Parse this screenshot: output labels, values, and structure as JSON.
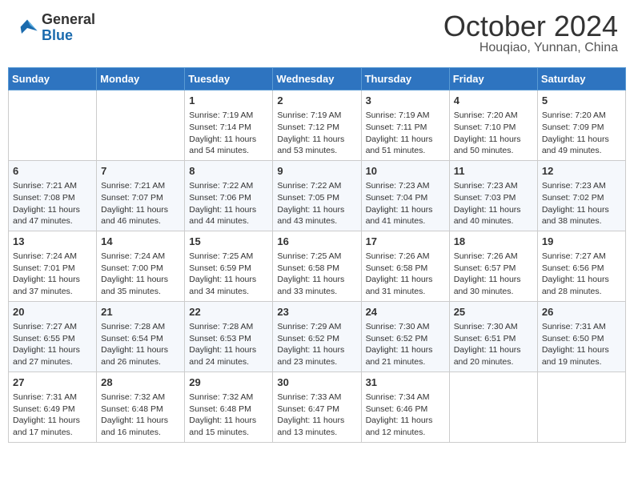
{
  "header": {
    "logo_general": "General",
    "logo_blue": "Blue",
    "title": "October 2024",
    "subtitle": "Houqiao, Yunnan, China"
  },
  "days_of_week": [
    "Sunday",
    "Monday",
    "Tuesday",
    "Wednesday",
    "Thursday",
    "Friday",
    "Saturday"
  ],
  "weeks": [
    [
      {
        "day": "",
        "info": ""
      },
      {
        "day": "",
        "info": ""
      },
      {
        "day": "1",
        "info": "Sunrise: 7:19 AM\nSunset: 7:14 PM\nDaylight: 11 hours and 54 minutes."
      },
      {
        "day": "2",
        "info": "Sunrise: 7:19 AM\nSunset: 7:12 PM\nDaylight: 11 hours and 53 minutes."
      },
      {
        "day": "3",
        "info": "Sunrise: 7:19 AM\nSunset: 7:11 PM\nDaylight: 11 hours and 51 minutes."
      },
      {
        "day": "4",
        "info": "Sunrise: 7:20 AM\nSunset: 7:10 PM\nDaylight: 11 hours and 50 minutes."
      },
      {
        "day": "5",
        "info": "Sunrise: 7:20 AM\nSunset: 7:09 PM\nDaylight: 11 hours and 49 minutes."
      }
    ],
    [
      {
        "day": "6",
        "info": "Sunrise: 7:21 AM\nSunset: 7:08 PM\nDaylight: 11 hours and 47 minutes."
      },
      {
        "day": "7",
        "info": "Sunrise: 7:21 AM\nSunset: 7:07 PM\nDaylight: 11 hours and 46 minutes."
      },
      {
        "day": "8",
        "info": "Sunrise: 7:22 AM\nSunset: 7:06 PM\nDaylight: 11 hours and 44 minutes."
      },
      {
        "day": "9",
        "info": "Sunrise: 7:22 AM\nSunset: 7:05 PM\nDaylight: 11 hours and 43 minutes."
      },
      {
        "day": "10",
        "info": "Sunrise: 7:23 AM\nSunset: 7:04 PM\nDaylight: 11 hours and 41 minutes."
      },
      {
        "day": "11",
        "info": "Sunrise: 7:23 AM\nSunset: 7:03 PM\nDaylight: 11 hours and 40 minutes."
      },
      {
        "day": "12",
        "info": "Sunrise: 7:23 AM\nSunset: 7:02 PM\nDaylight: 11 hours and 38 minutes."
      }
    ],
    [
      {
        "day": "13",
        "info": "Sunrise: 7:24 AM\nSunset: 7:01 PM\nDaylight: 11 hours and 37 minutes."
      },
      {
        "day": "14",
        "info": "Sunrise: 7:24 AM\nSunset: 7:00 PM\nDaylight: 11 hours and 35 minutes."
      },
      {
        "day": "15",
        "info": "Sunrise: 7:25 AM\nSunset: 6:59 PM\nDaylight: 11 hours and 34 minutes."
      },
      {
        "day": "16",
        "info": "Sunrise: 7:25 AM\nSunset: 6:58 PM\nDaylight: 11 hours and 33 minutes."
      },
      {
        "day": "17",
        "info": "Sunrise: 7:26 AM\nSunset: 6:58 PM\nDaylight: 11 hours and 31 minutes."
      },
      {
        "day": "18",
        "info": "Sunrise: 7:26 AM\nSunset: 6:57 PM\nDaylight: 11 hours and 30 minutes."
      },
      {
        "day": "19",
        "info": "Sunrise: 7:27 AM\nSunset: 6:56 PM\nDaylight: 11 hours and 28 minutes."
      }
    ],
    [
      {
        "day": "20",
        "info": "Sunrise: 7:27 AM\nSunset: 6:55 PM\nDaylight: 11 hours and 27 minutes."
      },
      {
        "day": "21",
        "info": "Sunrise: 7:28 AM\nSunset: 6:54 PM\nDaylight: 11 hours and 26 minutes."
      },
      {
        "day": "22",
        "info": "Sunrise: 7:28 AM\nSunset: 6:53 PM\nDaylight: 11 hours and 24 minutes."
      },
      {
        "day": "23",
        "info": "Sunrise: 7:29 AM\nSunset: 6:52 PM\nDaylight: 11 hours and 23 minutes."
      },
      {
        "day": "24",
        "info": "Sunrise: 7:30 AM\nSunset: 6:52 PM\nDaylight: 11 hours and 21 minutes."
      },
      {
        "day": "25",
        "info": "Sunrise: 7:30 AM\nSunset: 6:51 PM\nDaylight: 11 hours and 20 minutes."
      },
      {
        "day": "26",
        "info": "Sunrise: 7:31 AM\nSunset: 6:50 PM\nDaylight: 11 hours and 19 minutes."
      }
    ],
    [
      {
        "day": "27",
        "info": "Sunrise: 7:31 AM\nSunset: 6:49 PM\nDaylight: 11 hours and 17 minutes."
      },
      {
        "day": "28",
        "info": "Sunrise: 7:32 AM\nSunset: 6:48 PM\nDaylight: 11 hours and 16 minutes."
      },
      {
        "day": "29",
        "info": "Sunrise: 7:32 AM\nSunset: 6:48 PM\nDaylight: 11 hours and 15 minutes."
      },
      {
        "day": "30",
        "info": "Sunrise: 7:33 AM\nSunset: 6:47 PM\nDaylight: 11 hours and 13 minutes."
      },
      {
        "day": "31",
        "info": "Sunrise: 7:34 AM\nSunset: 6:46 PM\nDaylight: 11 hours and 12 minutes."
      },
      {
        "day": "",
        "info": ""
      },
      {
        "day": "",
        "info": ""
      }
    ]
  ]
}
